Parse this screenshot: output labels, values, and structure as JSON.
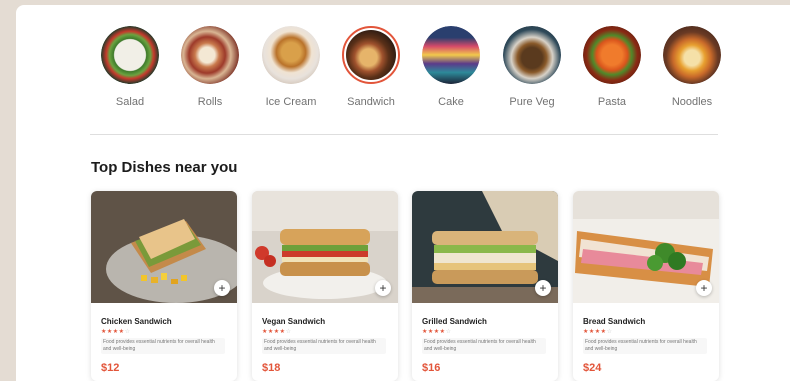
{
  "categories": [
    {
      "label": "Salad",
      "icon": "salad-icon",
      "selected": false
    },
    {
      "label": "Rolls",
      "icon": "rolls-icon",
      "selected": false
    },
    {
      "label": "Ice Cream",
      "icon": "ice-cream-icon",
      "selected": false
    },
    {
      "label": "Sandwich",
      "icon": "sandwich-icon",
      "selected": true
    },
    {
      "label": "Cake",
      "icon": "cake-icon",
      "selected": false
    },
    {
      "label": "Pure Veg",
      "icon": "pure-veg-icon",
      "selected": false
    },
    {
      "label": "Pasta",
      "icon": "pasta-icon",
      "selected": false
    },
    {
      "label": "Noodles",
      "icon": "noodles-icon",
      "selected": false
    }
  ],
  "section": {
    "title": "Top Dishes near you"
  },
  "dishes": [
    {
      "name": "Chicken Sandwich",
      "rating": 4,
      "description": "Food provides essential nutrients for overall health and well-being",
      "price": "$12",
      "add_label": "+"
    },
    {
      "name": "Vegan Sandwich",
      "rating": 4,
      "description": "Food provides essential nutrients for overall health and well-being",
      "price": "$18",
      "add_label": "+"
    },
    {
      "name": "Grilled Sandwich",
      "rating": 4,
      "description": "Food provides essential nutrients for overall health and well-being",
      "price": "$16",
      "add_label": "+"
    },
    {
      "name": "Bread Sandwich",
      "rating": 4,
      "description": "Food provides essential nutrients for overall health and well-being",
      "price": "$24",
      "add_label": "+"
    }
  ],
  "colors": {
    "accent": "#e2553a",
    "background": "#e4dcd3"
  }
}
